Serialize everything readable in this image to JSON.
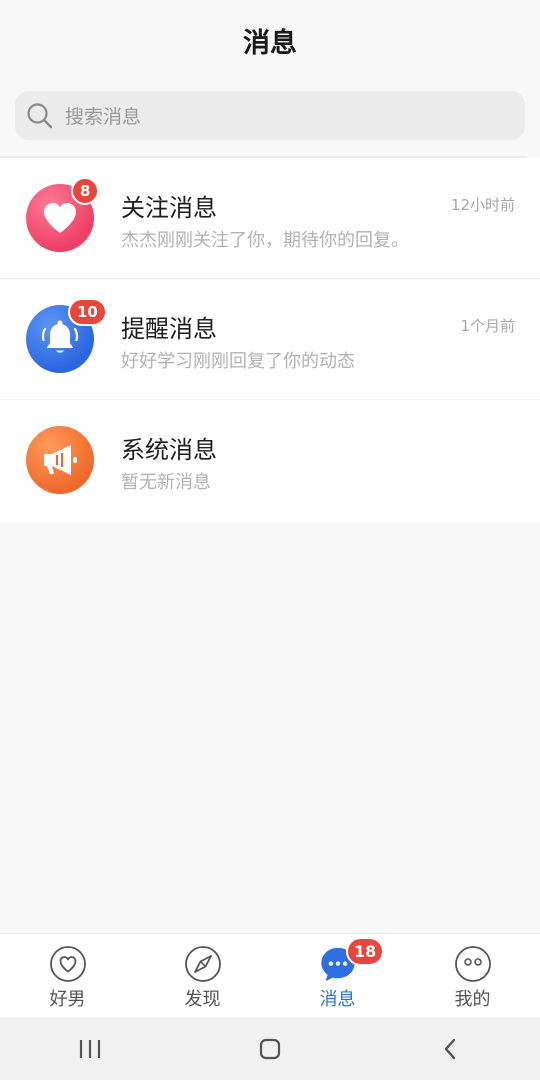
{
  "header": {
    "title": "消息"
  },
  "search": {
    "placeholder": "搜索消息",
    "icon": "search-icon"
  },
  "messages": [
    {
      "name": "关注消息",
      "preview": "杰杰刚刚关注了你，期待你的回复。",
      "time": "12小时前",
      "badge": "8",
      "icon": "heart-icon",
      "color": "#f0476a"
    },
    {
      "name": "提醒消息",
      "preview": "好好学习刚刚回复了你的动态",
      "time": "1个月前",
      "badge": "10",
      "icon": "bell-icon",
      "color": "#2f6fe4"
    },
    {
      "name": "系统消息",
      "preview": "暂无新消息",
      "time": "",
      "badge": "",
      "icon": "megaphone-icon",
      "color": "#f47a3a"
    }
  ],
  "tabbar": {
    "tabs": [
      {
        "label": "好男",
        "icon": "heart-outline-icon",
        "active": false
      },
      {
        "label": "发现",
        "icon": "compass-icon",
        "active": false
      },
      {
        "label": "消息",
        "icon": "chat-bubble-icon",
        "active": true,
        "badge": "18"
      },
      {
        "label": "我的",
        "icon": "face-icon",
        "active": false
      }
    ]
  },
  "colors": {
    "accent": "#2f6fe4",
    "badge": "#e8463c"
  }
}
